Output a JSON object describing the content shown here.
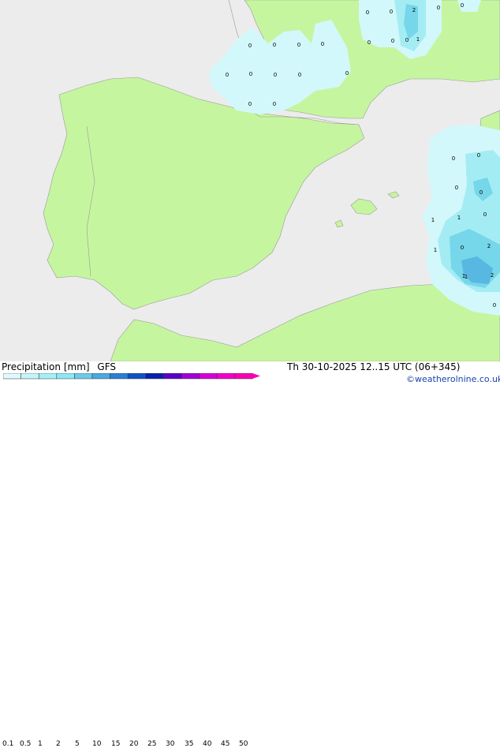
{
  "legend": {
    "title": "Precipitation [mm]",
    "model": "GFS",
    "ticks": [
      "0.1",
      "0.5",
      "1",
      "2",
      "5",
      "10",
      "15",
      "20",
      "25",
      "30",
      "35",
      "40",
      "45",
      "50"
    ],
    "colors": [
      "#dffbff",
      "#c4f5fb",
      "#a6eff7",
      "#8ee7f3",
      "#6ccbe9",
      "#4aa9de",
      "#2a7fd4",
      "#0f52c7",
      "#0a1fae",
      "#5a00c8",
      "#a000d6",
      "#d400d8",
      "#ef00c8",
      "#f700b0"
    ]
  },
  "valid_time": "Th 30-10-2025 12..15 UTC (06+345)",
  "credit": "©weatherolnine.co.uk",
  "colors": {
    "land": "#c6f5a0",
    "sea": "#ececec",
    "precip_light": "#d2f8fb",
    "precip_mid": "#a4ecf3",
    "precip_heavy": "#76d6ea",
    "precip_max": "#58b8e2"
  },
  "values": [
    "0",
    "0",
    "2",
    "0",
    "0",
    "0",
    "0",
    "0",
    "1",
    "0",
    "0",
    "0",
    "0",
    "0",
    "0",
    "0",
    "0",
    "0",
    "0",
    "0",
    "0",
    "0",
    "0",
    "1",
    "1",
    "0",
    "0",
    "1",
    "0",
    "2",
    "1",
    "1",
    "2",
    "0"
  ]
}
